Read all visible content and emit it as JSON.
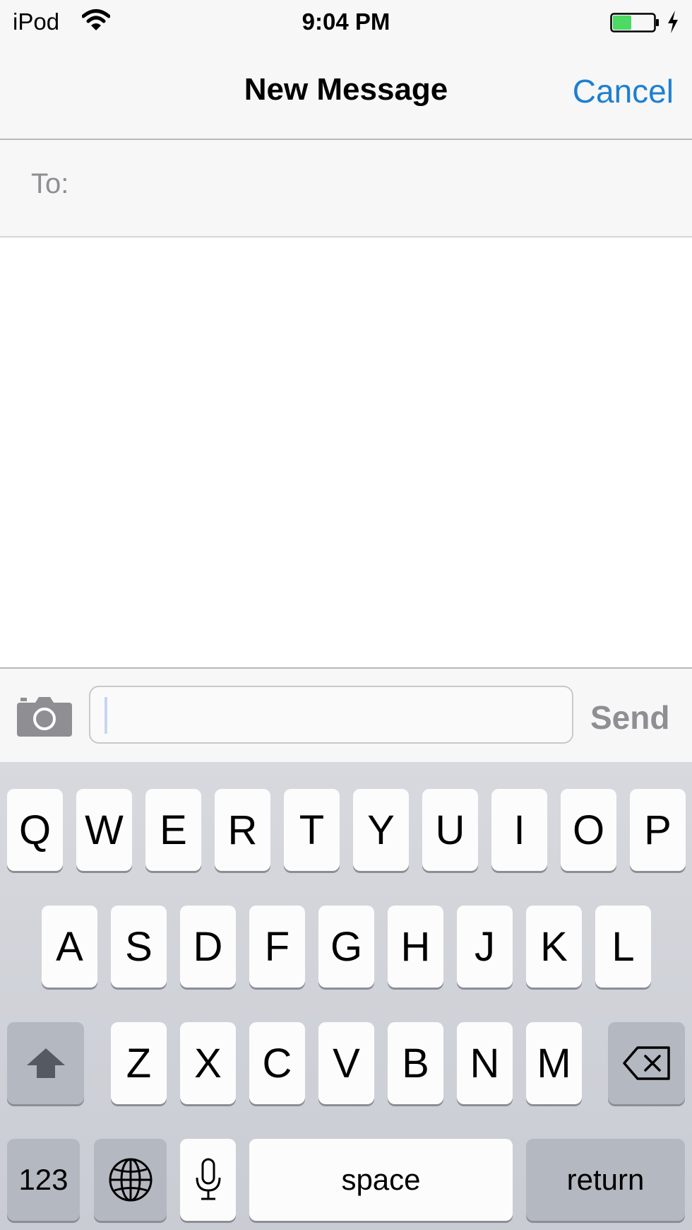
{
  "status_bar": {
    "carrier": "iPod",
    "time": "9:04 PM",
    "battery_level": 0.45
  },
  "nav": {
    "title": "New Message",
    "cancel_label": "Cancel"
  },
  "recipient": {
    "label": "To:",
    "value": ""
  },
  "compose": {
    "text": "",
    "send_label": "Send"
  },
  "keyboard": {
    "row1": [
      "Q",
      "W",
      "E",
      "R",
      "T",
      "Y",
      "U",
      "I",
      "O",
      "P"
    ],
    "row2": [
      "A",
      "S",
      "D",
      "F",
      "G",
      "H",
      "J",
      "K",
      "L"
    ],
    "row3": [
      "Z",
      "X",
      "C",
      "V",
      "B",
      "N",
      "M"
    ],
    "numbers_label": "123",
    "space_label": "space",
    "return_label": "return"
  },
  "icons": {
    "wifi": "wifi-icon",
    "battery": "battery-icon",
    "charging": "charging-bolt-icon",
    "camera": "camera-icon",
    "shift": "shift-arrow-icon",
    "delete": "delete-backspace-icon",
    "globe": "globe-icon",
    "microphone": "microphone-icon"
  },
  "colors": {
    "accent": "#1e7fd2",
    "battery_fill": "#4cd964",
    "disabled_text": "#8e8e93"
  }
}
